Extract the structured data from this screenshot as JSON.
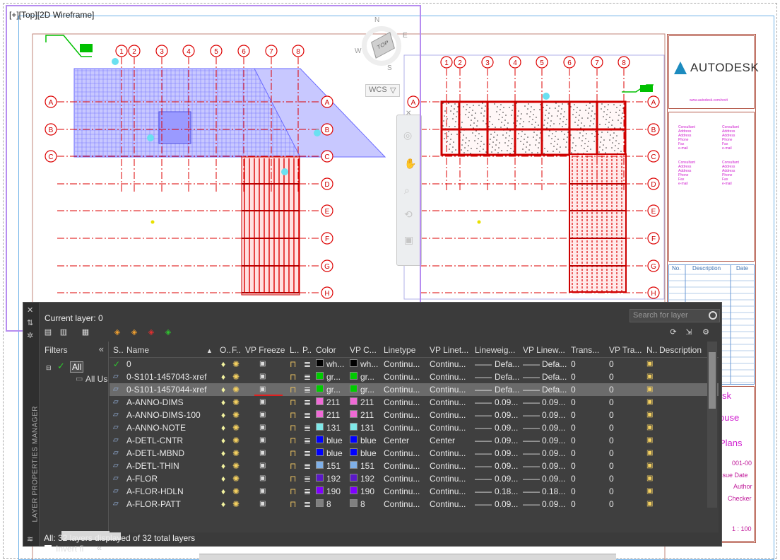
{
  "viewport": {
    "label": "[+][Top][2D Wireframe]",
    "wcs": "WCS",
    "viewcube": {
      "top": "TOP",
      "n": "N",
      "e": "E",
      "s": "S",
      "w": "W"
    }
  },
  "drawing": {
    "left_grid_numbers": [
      "1",
      "2",
      "3",
      "4",
      "5",
      "6",
      "7",
      "8"
    ],
    "left_grid_letters": [
      "A",
      "B",
      "C",
      "D",
      "E",
      "F",
      "G",
      "H"
    ],
    "right_grid_numbers": [
      "1",
      "2",
      "3",
      "4",
      "5",
      "6",
      "7",
      "8"
    ],
    "right_grid_letters": [
      "A",
      "B",
      "C",
      "D",
      "E",
      "F",
      "G",
      "H"
    ]
  },
  "title_block": {
    "brand": "AUTODESK",
    "url": "www.autodesk.com/revit",
    "consultants": [
      "Consultant\nAddress\nAddress\nPhone\nFax\ne-mail",
      "Consultant\nAddress\nAddress\nPhone\nFax\ne-mail",
      "Consultant\nAddress\nAddress\nPhone\nFax\ne-mail",
      "Consultant\nAddress\nAddress\nPhone\nFax\ne-mail"
    ],
    "rev_no": "No.",
    "rev_desc": "Description",
    "rev_date": "Date",
    "project_frag1": "sk",
    "project_frag2": "ouse",
    "project_frag3": "Plans",
    "number": "001-00",
    "issue_date": "ssue Date",
    "author": "Author",
    "checker": "Checker",
    "scale": "1 : 100"
  },
  "layer_manager": {
    "title": "LAYER PROPERTIES MANAGER",
    "current_layer": "Current layer: 0",
    "search_placeholder": "Search for layer",
    "filters_label": "Filters",
    "filter_all": "All",
    "filter_all_used": "All Us",
    "invert_filter": "Invert fi",
    "status": "All: 32 layers displayed of 32 total layers",
    "columns": {
      "status": "S..",
      "name": "Name",
      "on": "O..",
      "freeze": "F..",
      "vp_freeze": "VP Freeze",
      "lock": "L..",
      "plot": "P..",
      "color": "Color",
      "vp_color": "VP C...",
      "linetype": "Linetype",
      "vp_linetype": "VP Linet...",
      "lineweight": "Lineweig...",
      "vp_lineweight": "VP Linew...",
      "transparency": "Trans...",
      "vp_transparency": "VP Tra...",
      "new_vp_freeze": "N..",
      "description": "Description"
    },
    "rows": [
      {
        "name": "0",
        "current": true,
        "color": "wh...",
        "color_hex": "#000000",
        "vp_color": "wh...",
        "vp_color_hex": "#000000",
        "linetype": "Continu...",
        "vp_linetype": "Continu...",
        "lineweight": "Defa...",
        "vp_lineweight": "Defa...",
        "trans": "0",
        "vp_trans": "0"
      },
      {
        "name": "0-S101-1457043-xref",
        "current": false,
        "color": "gr...",
        "color_hex": "#00cc00",
        "vp_color": "gr...",
        "vp_color_hex": "#00cc00",
        "linetype": "Continu...",
        "vp_linetype": "Continu...",
        "lineweight": "Defa...",
        "vp_lineweight": "Defa...",
        "trans": "0",
        "vp_trans": "0"
      },
      {
        "name": "0-S101-1457044-xref",
        "current": false,
        "selected": true,
        "color": "gr...",
        "color_hex": "#00cc00",
        "vp_color": "gr...",
        "vp_color_hex": "#00cc00",
        "linetype": "Continu...",
        "vp_linetype": "Continu...",
        "lineweight": "Defa...",
        "vp_lineweight": "Defa...",
        "trans": "0",
        "vp_trans": "0"
      },
      {
        "name": "A-ANNO-DIMS",
        "current": false,
        "color": "211",
        "color_hex": "#f06ad6",
        "vp_color": "211",
        "vp_color_hex": "#f06ad6",
        "linetype": "Continu...",
        "vp_linetype": "Continu...",
        "lineweight": "0.09...",
        "vp_lineweight": "0.09...",
        "trans": "0",
        "vp_trans": "0"
      },
      {
        "name": "A-ANNO-DIMS-100",
        "current": false,
        "color": "211",
        "color_hex": "#f06ad6",
        "vp_color": "211",
        "vp_color_hex": "#f06ad6",
        "linetype": "Continu...",
        "vp_linetype": "Continu...",
        "lineweight": "0.09...",
        "vp_lineweight": "0.09...",
        "trans": "0",
        "vp_trans": "0"
      },
      {
        "name": "A-ANNO-NOTE",
        "current": false,
        "color": "131",
        "color_hex": "#7fe8e8",
        "vp_color": "131",
        "vp_color_hex": "#7fe8e8",
        "linetype": "Continu...",
        "vp_linetype": "Continu...",
        "lineweight": "0.09...",
        "vp_lineweight": "0.09...",
        "trans": "0",
        "vp_trans": "0"
      },
      {
        "name": "A-DETL-CNTR",
        "current": false,
        "color": "blue",
        "color_hex": "#0000ff",
        "vp_color": "blue",
        "vp_color_hex": "#0000ff",
        "linetype": "Center",
        "vp_linetype": "Center",
        "lineweight": "0.09...",
        "vp_lineweight": "0.09...",
        "trans": "0",
        "vp_trans": "0"
      },
      {
        "name": "A-DETL-MBND",
        "current": false,
        "color": "blue",
        "color_hex": "#0000ff",
        "vp_color": "blue",
        "vp_color_hex": "#0000ff",
        "linetype": "Continu...",
        "vp_linetype": "Continu...",
        "lineweight": "0.09...",
        "vp_lineweight": "0.09...",
        "trans": "0",
        "vp_trans": "0"
      },
      {
        "name": "A-DETL-THIN",
        "current": false,
        "color": "151",
        "color_hex": "#7fb0e8",
        "vp_color": "151",
        "vp_color_hex": "#7fb0e8",
        "linetype": "Continu...",
        "vp_linetype": "Continu...",
        "lineweight": "0.09...",
        "vp_lineweight": "0.09...",
        "trans": "0",
        "vp_trans": "0"
      },
      {
        "name": "A-FLOR",
        "current": false,
        "color": "192",
        "color_hex": "#5b18c8",
        "vp_color": "192",
        "vp_color_hex": "#5b18c8",
        "linetype": "Continu...",
        "vp_linetype": "Continu...",
        "lineweight": "0.09...",
        "vp_lineweight": "0.09...",
        "trans": "0",
        "vp_trans": "0"
      },
      {
        "name": "A-FLOR-HDLN",
        "current": false,
        "color": "190",
        "color_hex": "#7f00ff",
        "vp_color": "190",
        "vp_color_hex": "#7f00ff",
        "linetype": "Continu...",
        "vp_linetype": "Continu...",
        "lineweight": "0.18...",
        "vp_lineweight": "0.18...",
        "trans": "0",
        "vp_trans": "0"
      },
      {
        "name": "A-FLOR-PATT",
        "current": false,
        "color": "8",
        "color_hex": "#808080",
        "vp_color": "8",
        "vp_color_hex": "#808080",
        "linetype": "Continu...",
        "vp_linetype": "Continu...",
        "lineweight": "0.09...",
        "vp_lineweight": "0.09...",
        "trans": "0",
        "vp_trans": "0"
      }
    ]
  }
}
